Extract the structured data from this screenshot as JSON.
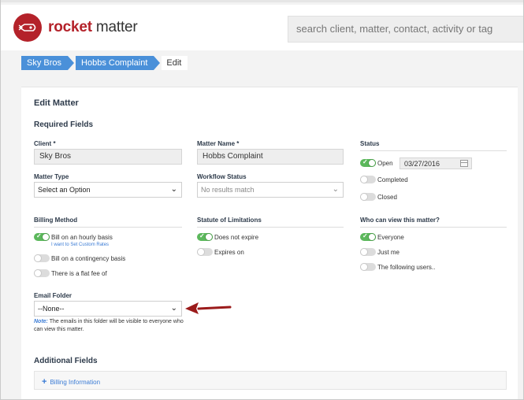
{
  "brand": {
    "name_bold": "rocket",
    "name_rest": " matter",
    "logo_icon": "rocket-logo-icon",
    "accent": "#b4222a"
  },
  "search": {
    "placeholder": "search client, matter, contact, activity or tag"
  },
  "breadcrumb": {
    "items": [
      "Sky Bros",
      "Hobbs Complaint"
    ],
    "current": "Edit"
  },
  "form": {
    "title": "Edit Matter",
    "required_title": "Required Fields",
    "client": {
      "label": "Client *",
      "value": "Sky Bros"
    },
    "matter_name": {
      "label": "Matter Name *",
      "value": "Hobbs Complaint"
    },
    "status": {
      "label": "Status",
      "options": [
        {
          "label": "Open",
          "on": true
        },
        {
          "label": "Completed",
          "on": false
        },
        {
          "label": "Closed",
          "on": false
        }
      ],
      "open_date": "03/27/2016"
    },
    "matter_type": {
      "label": "Matter Type",
      "value": "Select an Option"
    },
    "workflow_status": {
      "label": "Workflow Status",
      "value": "No results match"
    },
    "billing_method": {
      "label": "Billing Method",
      "options": [
        {
          "label": "Bill on an hourly basis",
          "on": true
        },
        {
          "label": "Bill on a contingency basis",
          "on": false
        },
        {
          "label": "There is a flat fee of",
          "on": false
        }
      ],
      "custom_rates_link": "I want to Set Custom Rates"
    },
    "statute": {
      "label": "Statute of Limitations",
      "options": [
        {
          "label": "Does not expire",
          "on": true
        },
        {
          "label": "Expires on",
          "on": false
        }
      ]
    },
    "visibility": {
      "label": "Who can view this matter?",
      "options": [
        {
          "label": "Everyone",
          "on": true
        },
        {
          "label": "Just me",
          "on": false
        },
        {
          "label": "The following users..",
          "on": false
        }
      ]
    },
    "email_folder": {
      "label": "Email Folder",
      "value": "--None--",
      "note_label": "Note:",
      "note_text": " The emails in this folder will be visible to everyone who can view this matter."
    },
    "additional_title": "Additional Fields",
    "billing_information": "Billing Information"
  },
  "annotation": {
    "arrow_color": "#9b1b1b"
  }
}
